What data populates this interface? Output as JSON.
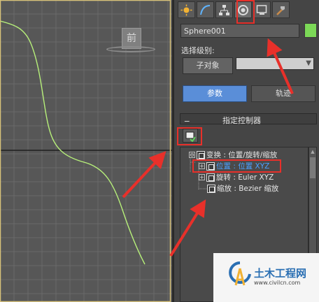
{
  "viewport": {
    "viewcube_label": "前"
  },
  "panel": {
    "tabs": [
      {
        "icon": "create-sun-icon"
      },
      {
        "icon": "modify-curve-icon"
      },
      {
        "icon": "hierarchy-icon"
      },
      {
        "icon": "motion-icon",
        "active": true
      },
      {
        "icon": "display-monitor-icon"
      },
      {
        "icon": "utilities-hammer-icon"
      }
    ],
    "object_name": "Sphere001",
    "object_color": "#7cd957",
    "selection_level_label": "选择级别:",
    "sub_object_label": "子对象",
    "sub_object_dropdown_value": "",
    "params_label": "参数",
    "trajectory_label": "轨迹",
    "rollout_title": "指定控制器",
    "tree": {
      "root": "变换 : 位置/旋转/缩放",
      "position": "位置 : 位置 XYZ",
      "rotation": "旋转 : Euler XYZ",
      "scale": "缩放 : Bezier 缩放"
    }
  },
  "watermark": {
    "title": "土木工程网",
    "url": "www.civilcn.com"
  },
  "colors": {
    "curve": "#b7f07a",
    "highlight": "#e8302a",
    "selected_text": "#4aa0ff",
    "active_button": "#5a8ed8"
  }
}
